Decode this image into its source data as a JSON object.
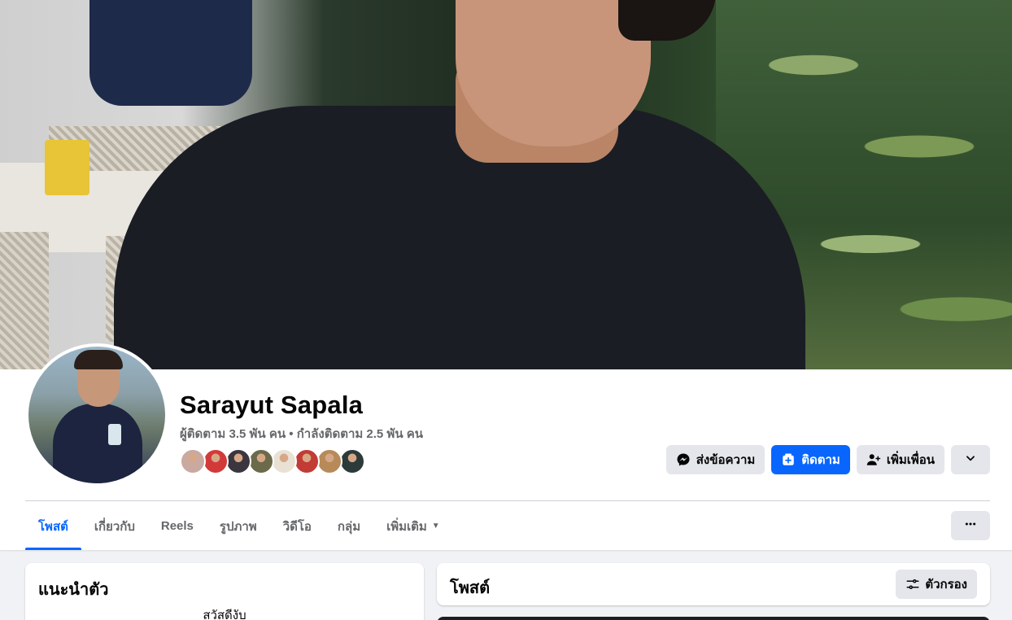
{
  "profile": {
    "name": "Sarayut Sapala",
    "stats": "ผู้ติดตาม 3.5 พัน คน • กำลังติดตาม 2.5 พัน คน"
  },
  "friends_preview": [
    {
      "color": "#c9a9a0"
    },
    {
      "color": "#d23a3a"
    },
    {
      "color": "#3b3540"
    },
    {
      "color": "#6b6a4a"
    },
    {
      "color": "#e9e2d4"
    },
    {
      "color": "#c23b34"
    },
    {
      "color": "#b88a5a"
    },
    {
      "color": "#2d3a3a"
    }
  ],
  "actions": {
    "message_label": "ส่งข้อความ",
    "follow_label": "ติดตาม",
    "add_friend_label": "เพิ่มเพื่อน"
  },
  "tabs": [
    {
      "label": "โพสต์",
      "active": true
    },
    {
      "label": "เกี่ยวกับ"
    },
    {
      "label": "Reels"
    },
    {
      "label": "รูปภาพ"
    },
    {
      "label": "วิดีโอ"
    },
    {
      "label": "กลุ่ม"
    },
    {
      "label": "เพิ่มเติม"
    }
  ],
  "intro": {
    "title": "แนะนำตัว",
    "bio": "สวัสดีงับ"
  },
  "posts": {
    "title": "โพสต์",
    "filter_label": "ตัวกรอง"
  },
  "colors": {
    "accent": "#0866ff",
    "button_gray": "#e4e6eb",
    "text_secondary": "#65676b"
  }
}
